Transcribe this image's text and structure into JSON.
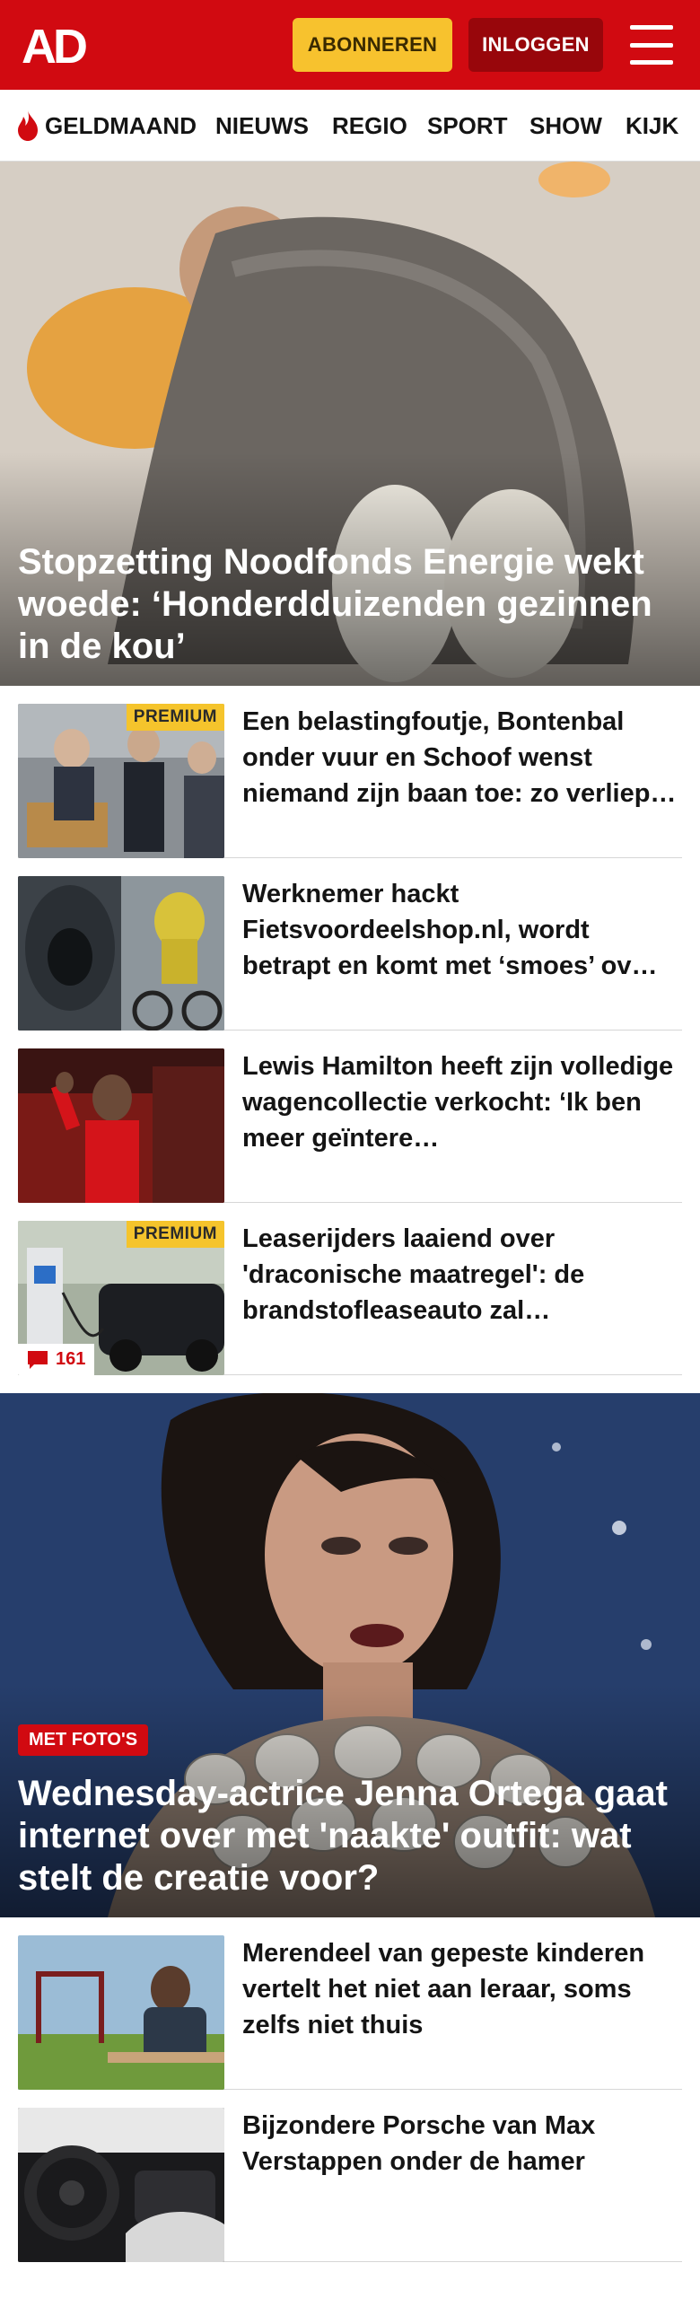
{
  "header": {
    "logo_text": "AD",
    "subscribe_label": "ABONNEREN",
    "login_label": "INLOGGEN"
  },
  "nav": {
    "items": [
      "GELDMAAND",
      "NIEUWS",
      "REGIO",
      "SPORT",
      "SHOW",
      "KIJK"
    ]
  },
  "hero1": {
    "title": "Stopzetting Noodfonds Energie wekt woede: ‘Honderdduizenden gezinnen in de kou’"
  },
  "list1": [
    {
      "title": "Een belastingfoutje, Bontenbal onder vuur en Schoof wenst niemand zijn baan toe: zo verliep…",
      "badge": "PREMIUM"
    },
    {
      "title": "Werknemer hackt Fietsvoordeelshop.nl, wordt betrapt en komt met ‘smoes’ ov…"
    },
    {
      "title": "Lewis Hamilton heeft zijn volledige wagencollectie verkocht: ‘Ik ben meer geïntere…"
    },
    {
      "title": "Leaserijders laaiend over 'draconische maatregel': de brandstofleaseauto zal…",
      "badge": "PREMIUM",
      "comments": "161"
    }
  ],
  "hero2": {
    "badge": "MET FOTO'S",
    "title": "Wednesday-actrice Jenna Ortega gaat internet over met 'naakte' outfit: wat stelt de creatie voor?"
  },
  "list2": [
    {
      "title": "Merendeel van gepeste kinderen vertelt het niet aan leraar, soms zelfs niet thuis"
    },
    {
      "title": "Bijzondere Porsche van Max Verstappen onder de hamer"
    }
  ],
  "colors": {
    "brand_red": "#d10a11",
    "subscribe_yellow": "#f7c22e",
    "premium_yellow": "#f5c42c"
  },
  "icons": [
    "flame-icon",
    "hamburger-menu-icon",
    "comment-icon"
  ]
}
